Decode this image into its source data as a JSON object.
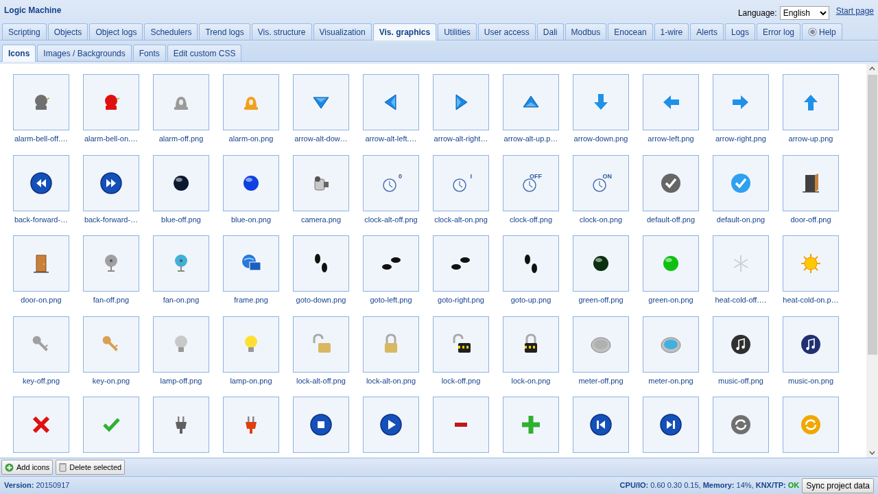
{
  "app_title": "Logic Machine",
  "language": {
    "label": "Language:",
    "value": "English"
  },
  "start_page": "Start page",
  "tabs": [
    {
      "label": "Scripting",
      "selected": false
    },
    {
      "label": "Objects",
      "selected": false
    },
    {
      "label": "Object logs",
      "selected": false
    },
    {
      "label": "Schedulers",
      "selected": false
    },
    {
      "label": "Trend logs",
      "selected": false
    },
    {
      "label": "Vis. structure",
      "selected": false
    },
    {
      "label": "Visualization",
      "selected": false
    },
    {
      "label": "Vis. graphics",
      "selected": true
    },
    {
      "label": "Utilities",
      "selected": false
    },
    {
      "label": "User access",
      "selected": false
    },
    {
      "label": "Dali",
      "selected": false
    },
    {
      "label": "Modbus",
      "selected": false
    },
    {
      "label": "Enocean",
      "selected": false
    },
    {
      "label": "1-wire",
      "selected": false
    },
    {
      "label": "Alerts",
      "selected": false
    },
    {
      "label": "Logs",
      "selected": false
    },
    {
      "label": "Error log",
      "selected": false
    },
    {
      "label": "Help",
      "selected": false,
      "kind": "help"
    }
  ],
  "subtabs": [
    {
      "label": "Icons",
      "selected": true
    },
    {
      "label": "Images / Backgrounds",
      "selected": false
    },
    {
      "label": "Fonts",
      "selected": false
    },
    {
      "label": "Edit custom CSS",
      "selected": false
    }
  ],
  "icons": [
    {
      "label": "alarm-bell-off.…",
      "kind": "bell",
      "color": "#707070"
    },
    {
      "label": "alarm-bell-on.…",
      "kind": "bell",
      "color": "#e01010"
    },
    {
      "label": "alarm-off.png",
      "kind": "beacon",
      "color": "#9a9a9a"
    },
    {
      "label": "alarm-on.png",
      "kind": "beacon",
      "color": "#f0a020"
    },
    {
      "label": "arrow-alt-dow…",
      "kind": "triangle-down"
    },
    {
      "label": "arrow-alt-left.…",
      "kind": "triangle-left"
    },
    {
      "label": "arrow-alt-right…",
      "kind": "triangle-right"
    },
    {
      "label": "arrow-alt-up.p…",
      "kind": "triangle-up"
    },
    {
      "label": "arrow-down.png",
      "kind": "arrow-down"
    },
    {
      "label": "arrow-left.png",
      "kind": "arrow-left"
    },
    {
      "label": "arrow-right.png",
      "kind": "arrow-right"
    },
    {
      "label": "arrow-up.png",
      "kind": "arrow-up"
    },
    {
      "label": "back-forward-…",
      "kind": "rewind"
    },
    {
      "label": "back-forward-…",
      "kind": "forward"
    },
    {
      "label": "blue-off.png",
      "kind": "orb",
      "color": "#0a1830"
    },
    {
      "label": "blue-on.png",
      "kind": "orb",
      "color": "#1040e0"
    },
    {
      "label": "camera.png",
      "kind": "camera"
    },
    {
      "label": "clock-alt-off.png",
      "kind": "clock",
      "badge": "0"
    },
    {
      "label": "clock-alt-on.png",
      "kind": "clock",
      "badge": "I"
    },
    {
      "label": "clock-off.png",
      "kind": "clock",
      "badge": "OFF"
    },
    {
      "label": "clock-on.png",
      "kind": "clock",
      "badge": "ON"
    },
    {
      "label": "default-off.png",
      "kind": "check",
      "color": "#666666"
    },
    {
      "label": "default-on.png",
      "kind": "check",
      "color": "#30a0f0"
    },
    {
      "label": "door-off.png",
      "kind": "door",
      "open": true
    },
    {
      "label": "door-on.png",
      "kind": "door",
      "open": false
    },
    {
      "label": "fan-off.png",
      "kind": "fan",
      "color": "#a0a0a0"
    },
    {
      "label": "fan-on.png",
      "kind": "fan",
      "color": "#40b0d8"
    },
    {
      "label": "frame.png",
      "kind": "frame"
    },
    {
      "label": "goto-down.png",
      "kind": "steps-down"
    },
    {
      "label": "goto-left.png",
      "kind": "steps-left"
    },
    {
      "label": "goto-right.png",
      "kind": "steps-right"
    },
    {
      "label": "goto-up.png",
      "kind": "steps-up"
    },
    {
      "label": "green-off.png",
      "kind": "orb",
      "color": "#0a3010"
    },
    {
      "label": "green-on.png",
      "kind": "orb",
      "color": "#10c010"
    },
    {
      "label": "heat-cold-off.…",
      "kind": "snowflake"
    },
    {
      "label": "heat-cold-on.p…",
      "kind": "sun"
    },
    {
      "label": "key-off.png",
      "kind": "key",
      "color": "#a0a0a0"
    },
    {
      "label": "key-on.png",
      "kind": "key",
      "color": "#d8a050"
    },
    {
      "label": "lamp-off.png",
      "kind": "lamp",
      "color": "#c8c8c8"
    },
    {
      "label": "lamp-on.png",
      "kind": "lamp",
      "color": "#ffe030"
    },
    {
      "label": "lock-alt-off.png",
      "kind": "padlock",
      "open": true
    },
    {
      "label": "lock-alt-on.png",
      "kind": "padlock",
      "open": false
    },
    {
      "label": "lock-off.png",
      "kind": "padlock",
      "open": true,
      "striped": true
    },
    {
      "label": "lock-on.png",
      "kind": "padlock",
      "open": false,
      "striped": true
    },
    {
      "label": "meter-off.png",
      "kind": "meter",
      "color": "#b0b0b0"
    },
    {
      "label": "meter-on.png",
      "kind": "meter",
      "color": "#40b0e0"
    },
    {
      "label": "music-off.png",
      "kind": "music",
      "color": "#303030"
    },
    {
      "label": "music-on.png",
      "kind": "music",
      "color": "#203070"
    },
    {
      "kind": "cross"
    },
    {
      "kind": "tick"
    },
    {
      "kind": "plug",
      "color": "#606060"
    },
    {
      "kind": "plug",
      "color": "#e04010"
    },
    {
      "kind": "stop"
    },
    {
      "kind": "play"
    },
    {
      "kind": "minus"
    },
    {
      "kind": "plus"
    },
    {
      "kind": "previous"
    },
    {
      "kind": "next"
    },
    {
      "kind": "refresh",
      "color": "#707070"
    },
    {
      "kind": "refresh",
      "color": "#f0a800"
    }
  ],
  "toolbar": [
    {
      "label": "Add icons",
      "kind": "add"
    },
    {
      "label": "Delete selected",
      "kind": "delete"
    }
  ],
  "status": {
    "version_label": "Version:",
    "version": "20150917",
    "cpu_label": "CPU/IO:",
    "cpu": "0.60 0.30 0.15,",
    "memory_label": "Memory:",
    "memory": "14%,",
    "knx_label": "KNX/TP:",
    "knx": "OK"
  },
  "sync_button": "Sync project data"
}
